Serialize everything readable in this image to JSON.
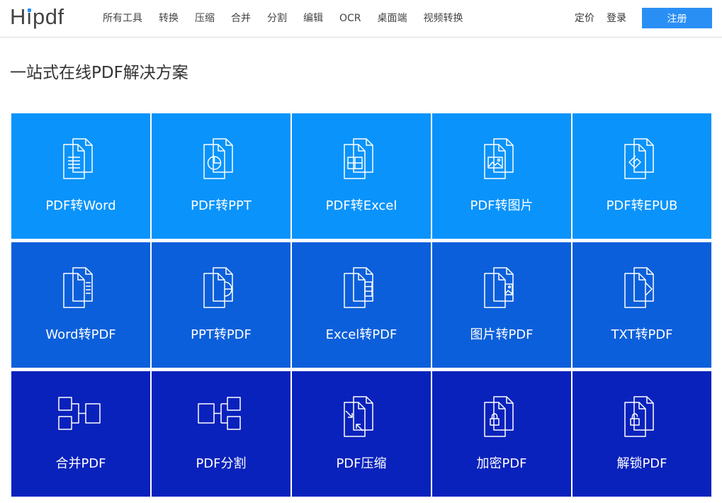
{
  "header": {
    "logo": "Hipdf",
    "nav": [
      "所有工具",
      "转换",
      "压缩",
      "合并",
      "分割",
      "编辑",
      "OCR",
      "桌面端",
      "视频转换"
    ],
    "pricing": "定价",
    "login": "登录",
    "signup": "注册"
  },
  "headline": "一站式在线PDF解决方案",
  "rows": [
    {
      "tiles": [
        {
          "label": "PDF转Word",
          "icon": "doc-lines-icon"
        },
        {
          "label": "PDF转PPT",
          "icon": "doc-pie-icon"
        },
        {
          "label": "PDF转Excel",
          "icon": "doc-table-icon"
        },
        {
          "label": "PDF转图片",
          "icon": "doc-image-icon"
        },
        {
          "label": "PDF转EPUB",
          "icon": "doc-epub-icon"
        }
      ]
    },
    {
      "tiles": [
        {
          "label": "Word转PDF",
          "icon": "word-to-pdf-icon"
        },
        {
          "label": "PPT转PDF",
          "icon": "ppt-to-pdf-icon"
        },
        {
          "label": "Excel转PDF",
          "icon": "excel-to-pdf-icon"
        },
        {
          "label": "图片转PDF",
          "icon": "image-to-pdf-icon"
        },
        {
          "label": "TXT转PDF",
          "icon": "txt-to-pdf-icon"
        }
      ]
    },
    {
      "tiles": [
        {
          "label": "合并PDF",
          "icon": "merge-icon"
        },
        {
          "label": "PDF分割",
          "icon": "split-icon"
        },
        {
          "label": "PDF压缩",
          "icon": "compress-icon"
        },
        {
          "label": "加密PDF",
          "icon": "lock-icon"
        },
        {
          "label": "解锁PDF",
          "icon": "unlock-icon"
        }
      ]
    }
  ],
  "colors": {
    "row1": "#0a93fa",
    "row2": "#0c5fda",
    "row3": "#0a22bc",
    "signup": "#2a8ff5",
    "logo_dot": "#1e90ff"
  }
}
